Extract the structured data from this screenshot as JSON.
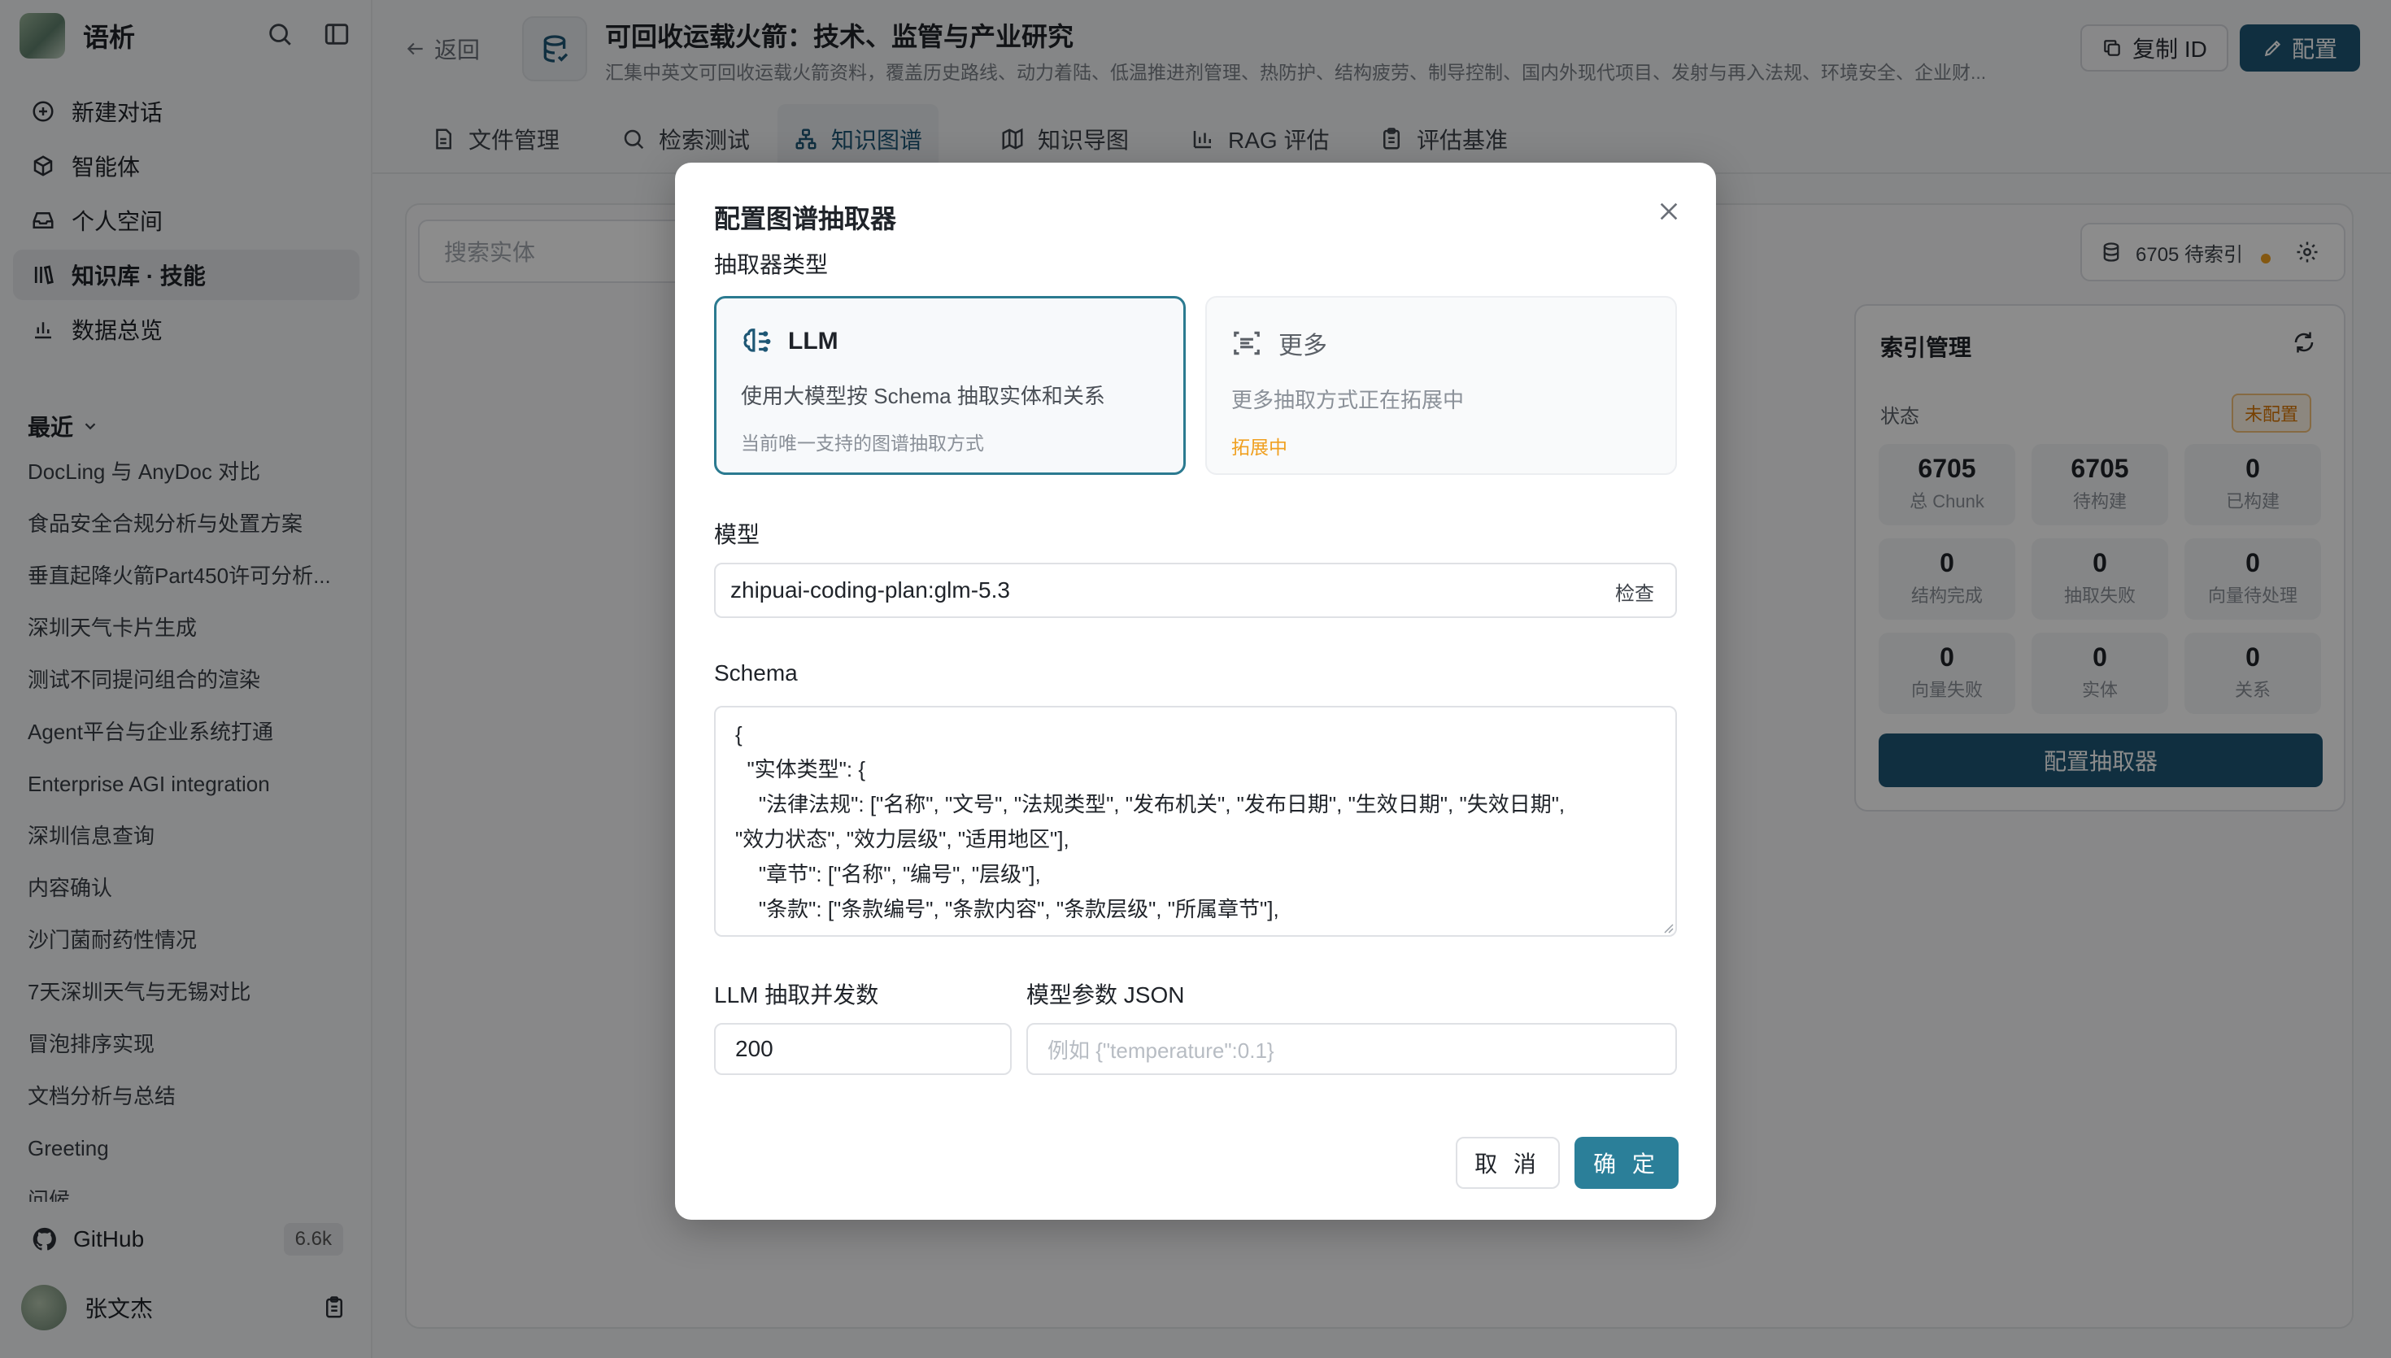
{
  "sidebar": {
    "brand": "语析",
    "nav": [
      {
        "label": "新建对话",
        "icon": "plus-circle-icon"
      },
      {
        "label": "智能体",
        "icon": "cube-icon"
      },
      {
        "label": "个人空间",
        "icon": "inbox-icon"
      },
      {
        "label": "知识库 · 技能",
        "icon": "library-icon"
      },
      {
        "label": "数据总览",
        "icon": "bar-chart-icon"
      }
    ],
    "recent_title": "最近",
    "recent": [
      "DocLing 与 AnyDoc 对比",
      "食品安全合规分析与处置方案",
      "垂直起降火箭Part450许可分析...",
      "深圳天气卡片生成",
      "测试不同提问组合的渲染",
      "Agent平台与企业系统打通",
      "Enterprise AGI integration",
      "深圳信息查询",
      "内容确认",
      "沙门菌耐药性情况",
      "7天深圳天气与无锡对比",
      "冒泡排序实现",
      "文档分析与总结",
      "Greeting",
      "问候"
    ],
    "github_label": "GitHub",
    "github_stars": "6.6k",
    "user_name": "张文杰"
  },
  "header": {
    "back": "返回",
    "title": "可回收运载火箭：技术、监管与产业研究",
    "subtitle": "汇集中英文可回收运载火箭资料，覆盖历史路线、动力着陆、低温推进剂管理、热防护、结构疲劳、制导控制、国内外现代项目、发射与再入法规、环境安全、企业财...",
    "copy_id": "复制 ID",
    "config": "配置"
  },
  "tabs": [
    {
      "label": "文件管理",
      "icon": "file-icon"
    },
    {
      "label": "检索测试",
      "icon": "search-icon"
    },
    {
      "label": "知识图谱",
      "icon": "graph-icon"
    },
    {
      "label": "知识导图",
      "icon": "map-icon"
    },
    {
      "label": "RAG 评估",
      "icon": "chart-icon"
    },
    {
      "label": "评估基准",
      "icon": "clipboard-icon"
    }
  ],
  "content": {
    "search_placeholder": "搜索实体",
    "pending": "6705 待索引"
  },
  "index_panel": {
    "title": "索引管理",
    "status_label": "状态",
    "status_badge": "未配置",
    "stats": [
      {
        "value": "6705",
        "label": "总 Chunk"
      },
      {
        "value": "6705",
        "label": "待构建"
      },
      {
        "value": "0",
        "label": "已构建"
      },
      {
        "value": "0",
        "label": "结构完成"
      },
      {
        "value": "0",
        "label": "抽取失败"
      },
      {
        "value": "0",
        "label": "向量待处理"
      },
      {
        "value": "0",
        "label": "向量失败"
      },
      {
        "value": "0",
        "label": "实体"
      },
      {
        "value": "0",
        "label": "关系"
      }
    ],
    "config_button": "配置抽取器"
  },
  "modal": {
    "title": "配置图谱抽取器",
    "type_label": "抽取器类型",
    "llm_card": {
      "title": "LLM",
      "desc": "使用大模型按 Schema 抽取实体和关系",
      "note": "当前唯一支持的图谱抽取方式"
    },
    "more_card": {
      "title": "更多",
      "desc": "更多抽取方式正在拓展中",
      "note": "拓展中"
    },
    "model_label": "模型",
    "model_value": "zhipuai-coding-plan:glm-5.3",
    "check": "检查",
    "schema_label": "Schema",
    "schema_text": "{\n  \"实体类型\": {\n    \"法律法规\": [\"名称\", \"文号\", \"法规类型\", \"发布机关\", \"发布日期\", \"生效日期\", \"失效日期\",\n\"效力状态\", \"效力层级\", \"适用地区\"],\n    \"章节\": [\"名称\", \"编号\", \"层级\"],\n    \"条款\": [\"条款编号\", \"条款内容\", \"条款层级\", \"所属章节\"],",
    "concurrency_label": "LLM 抽取并发数",
    "concurrency_value": "200",
    "params_label": "模型参数 JSON",
    "params_placeholder": "例如 {\"temperature\":0.1}",
    "cancel": "取 消",
    "ok": "确 定"
  },
  "colors": {
    "accent": "#1e5775",
    "primary": "#2b7f99",
    "warning": "#f0a020"
  }
}
